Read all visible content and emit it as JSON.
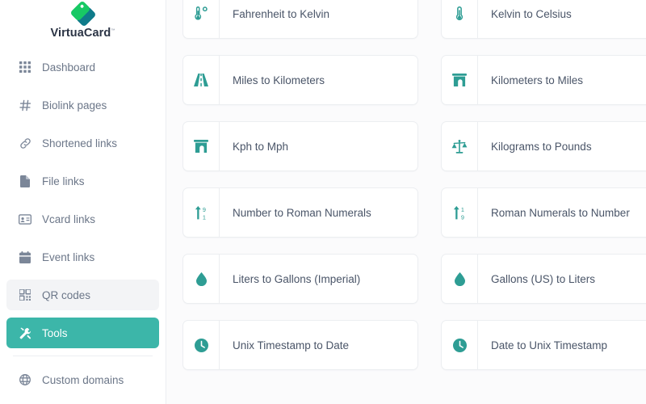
{
  "brand": {
    "name": "VirtuaCard",
    "trademark": "™",
    "logo_colors": {
      "left": "#18c964",
      "right": "#0f7b8a"
    }
  },
  "theme": {
    "accent": "#3cb6a9",
    "icon_teal": "#2e9d94",
    "text": "#4a5568",
    "muted": "#6b7688",
    "card_bg": "#ffffff",
    "page_bg": "#fbfbfc",
    "border": "#eceef1"
  },
  "sidebar": {
    "items": [
      {
        "label": "Dashboard",
        "icon": "grid-icon",
        "state": "default"
      },
      {
        "label": "Biolink pages",
        "icon": "hash-icon",
        "state": "default"
      },
      {
        "label": "Shortened links",
        "icon": "link-icon",
        "state": "default"
      },
      {
        "label": "File links",
        "icon": "file-icon",
        "state": "default"
      },
      {
        "label": "Vcard links",
        "icon": "id-card-icon",
        "state": "default"
      },
      {
        "label": "Event links",
        "icon": "calendar-icon",
        "state": "default"
      },
      {
        "label": "QR codes",
        "icon": "qr-code-icon",
        "state": "hovered"
      },
      {
        "label": "Tools",
        "icon": "tools-icon",
        "state": "active"
      }
    ],
    "footer_items": [
      {
        "label": "Custom domains",
        "icon": "globe-icon",
        "state": "default"
      }
    ]
  },
  "main": {
    "tools": [
      {
        "label": "Fahrenheit to Kelvin",
        "icon": "thermometer-degrees-icon"
      },
      {
        "label": "Kelvin to Celsius",
        "icon": "thermometer-icon"
      },
      {
        "label": "Miles to Kilometers",
        "icon": "road-icon"
      },
      {
        "label": "Kilometers to Miles",
        "icon": "gauge-icon"
      },
      {
        "label": "Kph to Mph",
        "icon": "gauge-icon"
      },
      {
        "label": "Kilograms to Pounds",
        "icon": "balance-scale-icon"
      },
      {
        "label": "Number to Roman Numerals",
        "icon": "sort-numeric-up-icon"
      },
      {
        "label": "Roman Numerals to Number",
        "icon": "sort-numeric-down-icon"
      },
      {
        "label": "Liters to Gallons (Imperial)",
        "icon": "water-drop-icon"
      },
      {
        "label": "Gallons (US) to Liters",
        "icon": "water-drop-icon"
      },
      {
        "label": "Unix Timestamp to Date",
        "icon": "clock-icon"
      },
      {
        "label": "Date to Unix Timestamp",
        "icon": "clock-icon"
      }
    ]
  }
}
